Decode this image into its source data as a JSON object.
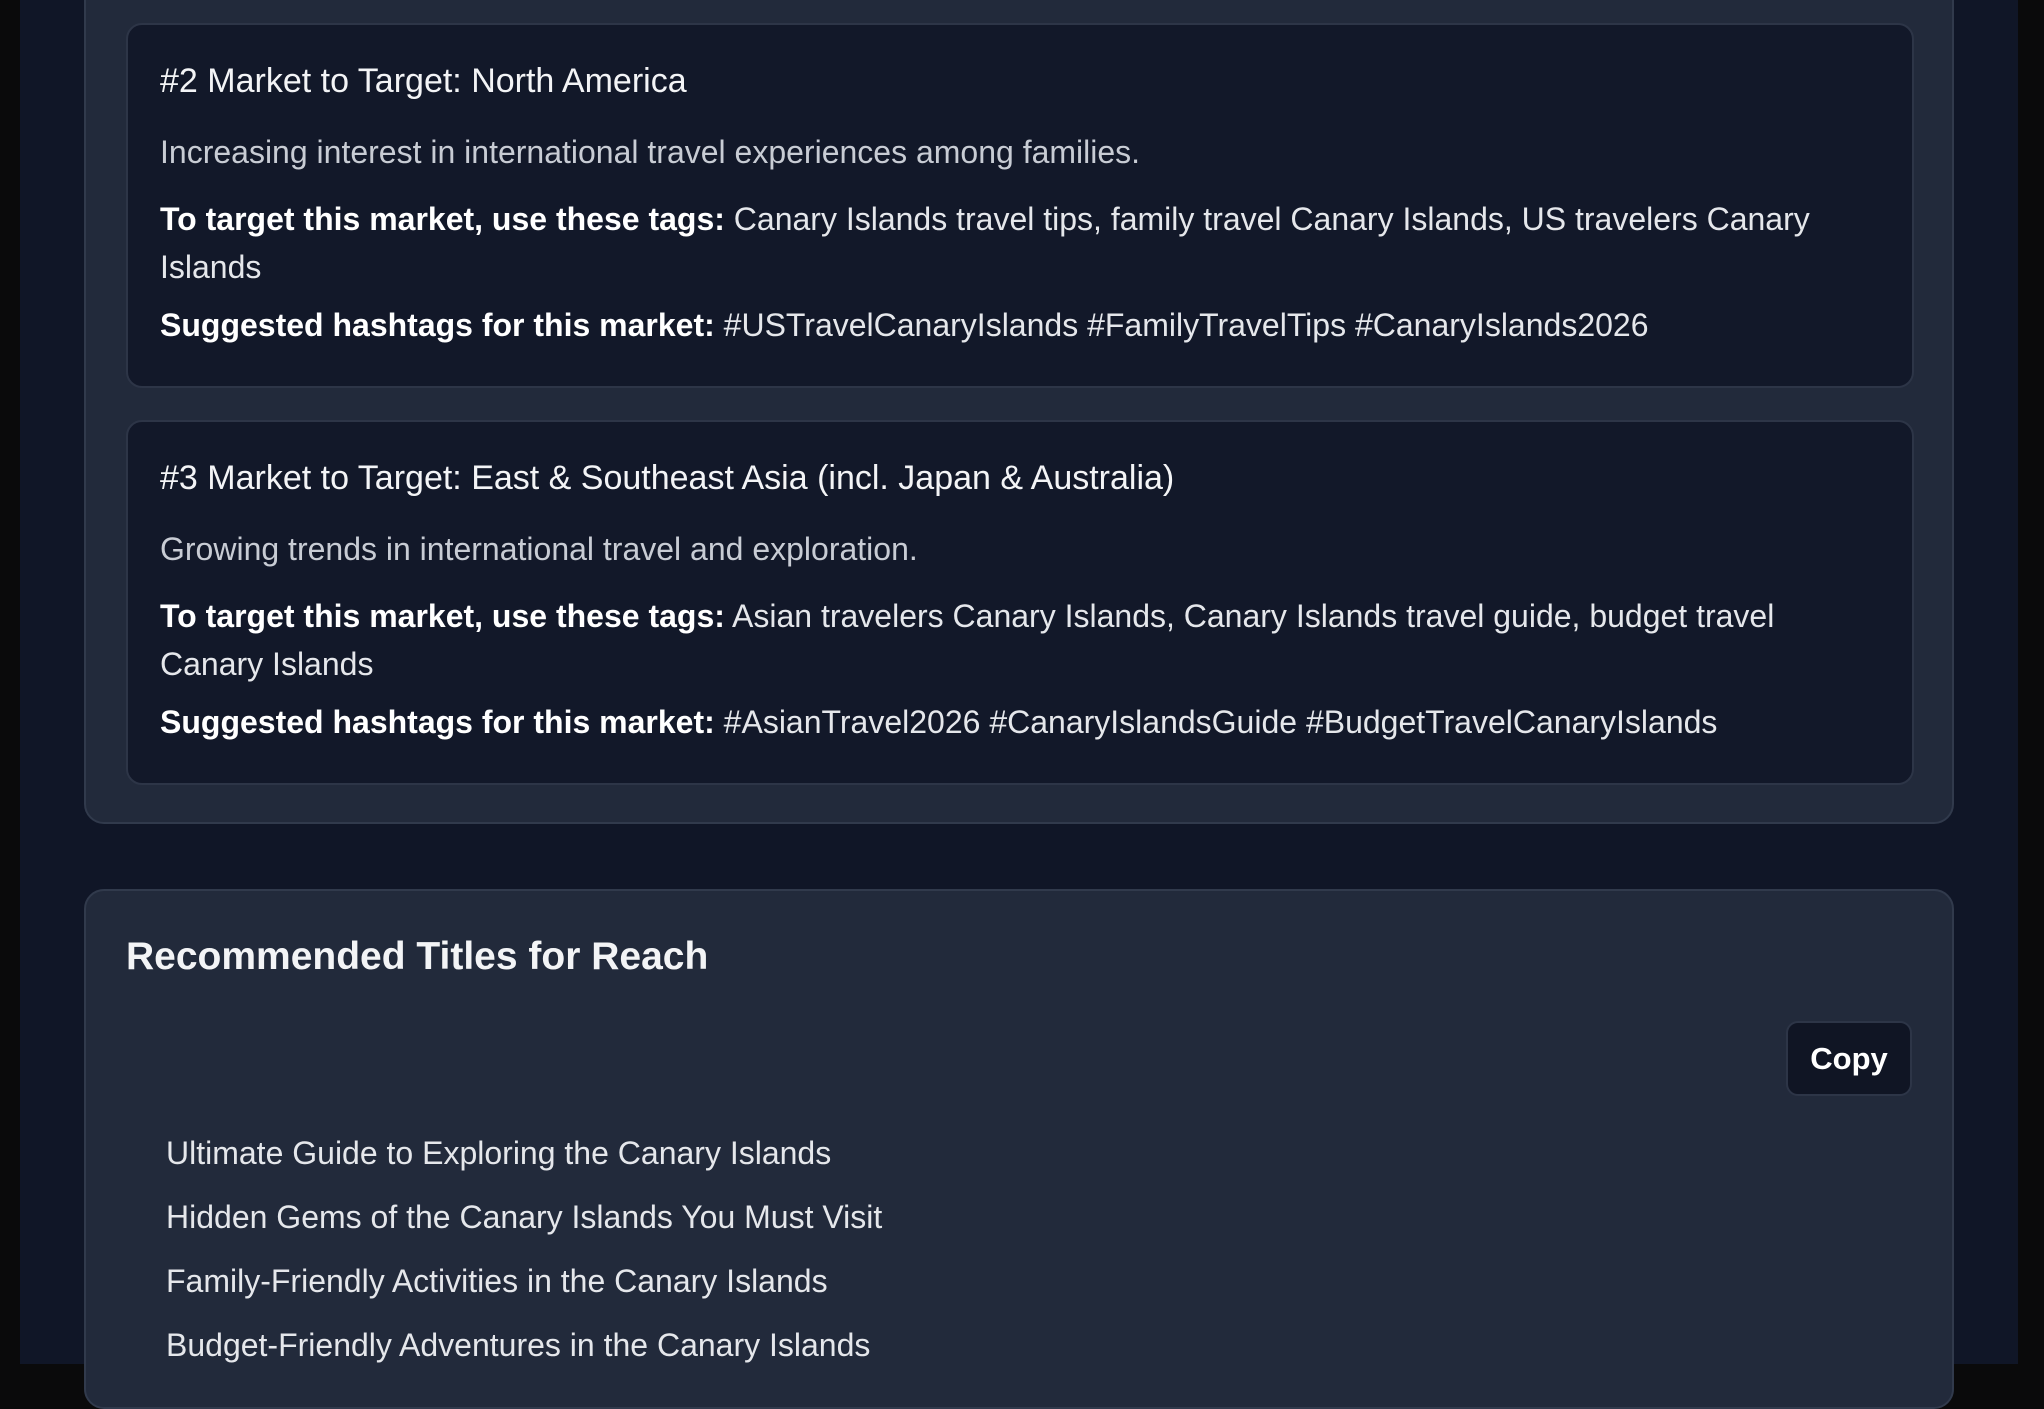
{
  "markets": [
    {
      "title": "#2 Market to Target: North America",
      "description": "Increasing interest in international travel experiences among families.",
      "tags_label": "To target this market, use these tags:",
      "tags": "Canary Islands travel tips, family travel Canary Islands, US travelers Canary Islands",
      "hashtags_label": "Suggested hashtags for this market:",
      "hashtags": "#USTravelCanaryIslands #FamilyTravelTips #CanaryIslands2026"
    },
    {
      "title": "#3 Market to Target: East & Southeast Asia (incl. Japan & Australia)",
      "description": "Growing trends in international travel and exploration.",
      "tags_label": "To target this market, use these tags:",
      "tags": "Asian travelers Canary Islands, Canary Islands travel guide, budget travel Canary Islands",
      "hashtags_label": "Suggested hashtags for this market:",
      "hashtags": "#AsianTravel2026 #CanaryIslandsGuide #BudgetTravelCanaryIslands"
    }
  ],
  "recommended_titles": {
    "heading": "Recommended Titles for Reach",
    "copy_label": "Copy",
    "items": [
      "Ultimate Guide to Exploring the Canary Islands",
      "Hidden Gems of the Canary Islands You Must Visit",
      "Family-Friendly Activities in the Canary Islands",
      "Budget-Friendly Adventures in the Canary Islands"
    ]
  }
}
